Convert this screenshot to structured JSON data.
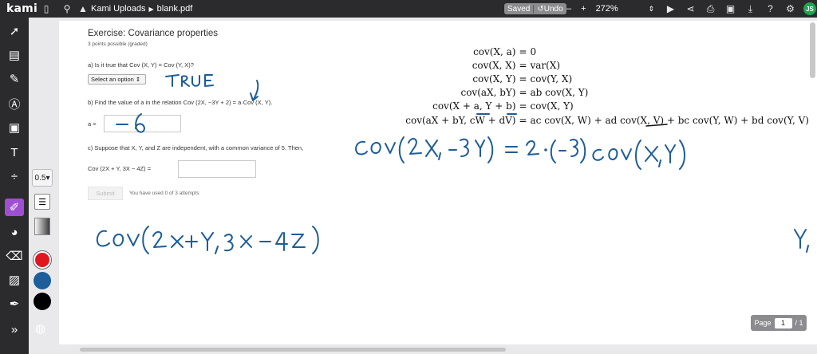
{
  "topbar": {
    "logo": "kami",
    "breadcrumb_folder": "Kami Uploads",
    "breadcrumb_file": "blank.pdf",
    "saved": "Saved",
    "undo": "Undo",
    "zoom_out": "–",
    "zoom_in": "+",
    "zoom": "272%",
    "avatar": "JS"
  },
  "palette": {
    "size": "0.5",
    "colors": {
      "red": "#e0161e",
      "blue": "#1d5d99",
      "black": "#000000"
    }
  },
  "exercise": {
    "title": "Exercise: Covariance properties",
    "points": "3 points possible (graded)",
    "qa": "a) Is it true that Cov (X, Y) = Cov (Y, X)?",
    "select": "Select an option",
    "qb": "b) Find the value of a in the relation Cov (2X, −3Y + 2) = a·Cov (X, Y).",
    "a_label": "a =",
    "qc": "c) Suppose that X, Y, and Z are independent, with a common variance of 5. Then,",
    "cov_label": "Cov (2X + Y, 3X − 4Z) =",
    "submit": "Submit",
    "attempts": "You have used 0 of 3 attempts"
  },
  "formulas": [
    {
      "left": "cov(X, a)",
      "right": "0"
    },
    {
      "left": "cov(X, X)",
      "right": "var(X)"
    },
    {
      "left": "cov(X, Y)",
      "right": "cov(Y, X)"
    },
    {
      "left": "cov(aX, bY)",
      "right": "ab cov(X, Y)"
    },
    {
      "left": "cov(X + a, Y + b)",
      "right": "cov(X, Y)"
    },
    {
      "left": "cov(aX + bY, cW + dV)",
      "right": "ac cov(X, W) + ad cov(X, V) + bc cov(Y, W) + bd cov(Y, V)"
    }
  ],
  "formula_eq": "=",
  "pager": {
    "label": "Page",
    "current": "1",
    "total": "/ 1"
  }
}
